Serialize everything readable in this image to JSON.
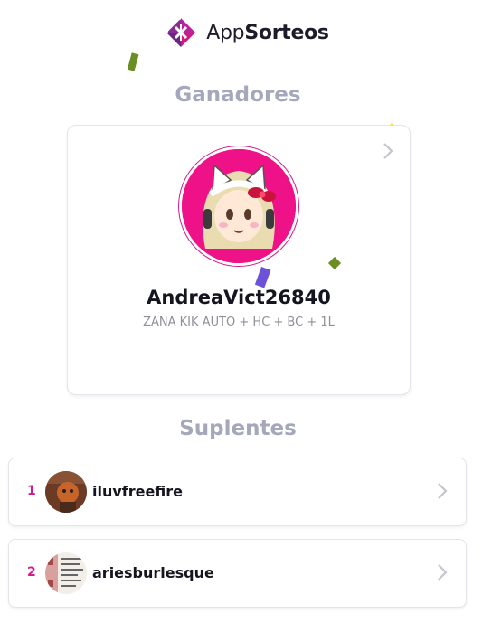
{
  "header": {
    "brand_prefix": "App",
    "brand_suffix": "Sorteos",
    "logo_icon": "appsorteos-logo-icon"
  },
  "winners": {
    "title": "Ganadores",
    "winner": {
      "username": "AndreaVict26840",
      "comment": "ZANA KIK AUTO + HC + BC + 1L"
    }
  },
  "alternates": {
    "title": "Suplentes",
    "items": [
      {
        "rank": "1",
        "username": "iluvfreefire"
      },
      {
        "rank": "2",
        "username": "ariesburlesque"
      }
    ]
  },
  "colors": {
    "accent": "#d21b8a",
    "section_title": "#a5a8bb",
    "text": "#15151f",
    "muted": "#8f8f99"
  }
}
